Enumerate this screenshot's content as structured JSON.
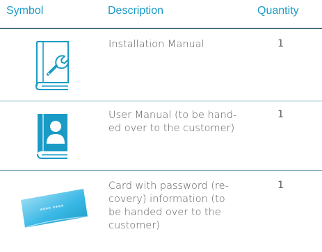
{
  "table": {
    "headers": {
      "symbol": "Symbol",
      "description": "Description",
      "quantity": "Quantity"
    },
    "rows": [
      {
        "icon": "installation-manual-book-icon",
        "description": "Installation Manual",
        "quantity": "1"
      },
      {
        "icon": "user-manual-book-icon",
        "description_lines": [
          "User Manual (to be hand-",
          "ed over to the customer)"
        ],
        "quantity": "1"
      },
      {
        "icon": "password-card-icon",
        "description_lines": [
          "Card with password (re-",
          "covery) information (to",
          "be handed over to the",
          "customer)"
        ],
        "quantity": "1",
        "card_text": "**** ****"
      }
    ]
  },
  "colors": {
    "accent": "#1a9bc6",
    "rule": "#4a6f80",
    "text": "#5c5c5c"
  }
}
